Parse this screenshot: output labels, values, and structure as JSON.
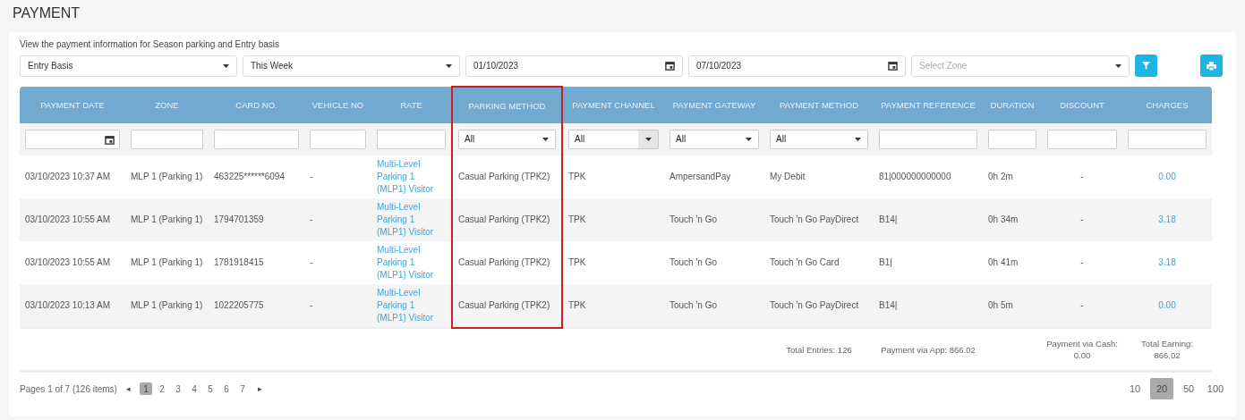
{
  "page_title": "PAYMENT",
  "description": "View the payment information for Season parking and Entry basis",
  "filters": [
    {
      "kind": "select",
      "value": "Entry Basis"
    },
    {
      "kind": "select",
      "value": "This Week"
    },
    {
      "kind": "date",
      "value": "01/10/2023"
    },
    {
      "kind": "date",
      "value": "07/10/2023"
    },
    {
      "kind": "select",
      "placeholder": "Select Zone"
    }
  ],
  "table": {
    "columns": [
      {
        "label": "PAYMENT DATE",
        "filter": {
          "kind": "date"
        },
        "highlighted": false
      },
      {
        "label": "ZONE",
        "filter": {
          "kind": "text"
        },
        "highlighted": false
      },
      {
        "label": "CARD NO.",
        "filter": {
          "kind": "text"
        },
        "highlighted": false
      },
      {
        "label": "VEHICLE NO",
        "filter": {
          "kind": "text"
        },
        "highlighted": false
      },
      {
        "label": "RATE",
        "filter": {
          "kind": "text"
        },
        "highlighted": false
      },
      {
        "label": "PARKING METHOD",
        "filter": {
          "kind": "select",
          "value": "All"
        },
        "highlighted": true
      },
      {
        "label": "PAYMENT CHANNEL",
        "filter": {
          "kind": "combo",
          "value": "All"
        },
        "highlighted": false
      },
      {
        "label": "PAYMENT GATEWAY",
        "filter": {
          "kind": "select",
          "value": "All"
        },
        "highlighted": false
      },
      {
        "label": "PAYMENT METHOD",
        "filter": {
          "kind": "select",
          "value": "All"
        },
        "highlighted": false
      },
      {
        "label": "PAYMENT REFERENCE",
        "filter": {
          "kind": "text"
        },
        "highlighted": false
      },
      {
        "label": "DURATION",
        "filter": {
          "kind": "text"
        },
        "highlighted": false
      },
      {
        "label": "DISCOUNT",
        "filter": {
          "kind": "text"
        },
        "highlighted": false
      },
      {
        "label": "CHARGES",
        "filter": {
          "kind": "text"
        },
        "highlighted": false
      }
    ],
    "rows": [
      [
        "03/10/2023 10:37 AM",
        "MLP 1 (Parking 1)",
        "463225******6094",
        "-",
        "Multi-Level Parking 1 (MLP1) Visitor",
        "Casual Parking (TPK2)",
        "TPK",
        "AmpersandPay",
        "My Debit",
        "81|000000000000",
        "0h 2m",
        "-",
        "0.00"
      ],
      [
        "03/10/2023 10:55 AM",
        "MLP 1 (Parking 1)",
        "1794701359",
        "-",
        "Multi-Level Parking 1 (MLP1) Visitor",
        "Casual Parking (TPK2)",
        "TPK",
        "Touch 'n Go",
        "Touch 'n Go PayDirect",
        "B14|",
        "0h 34m",
        "-",
        "3.18"
      ],
      [
        "03/10/2023 10:55 AM",
        "MLP 1 (Parking 1)",
        "1781918415",
        "-",
        "Multi-Level Parking 1 (MLP1) Visitor",
        "Casual Parking (TPK2)",
        "TPK",
        "Touch 'n Go",
        "Touch 'n Go Card",
        "B1|",
        "0h 41m",
        "-",
        "3.18"
      ],
      [
        "03/10/2023 10:13 AM",
        "MLP 1 (Parking 1)",
        "1022205775",
        "-",
        "Multi-Level Parking 1 (MLP1) Visitor",
        "Casual Parking (TPK2)",
        "TPK",
        "Touch 'n Go",
        "Touch 'n Go PayDirect",
        "B14|",
        "0h 5m",
        "-",
        "0.00"
      ]
    ],
    "totals": [
      {
        "lines": [
          "Total Entries: 126"
        ]
      },
      {
        "lines": [
          "Payment via App: 866.02"
        ]
      },
      {
        "lines": [
          "Payment via Cash:",
          "0.00"
        ]
      },
      {
        "lines": [
          "Total Earning:",
          "866.02"
        ]
      }
    ]
  },
  "pagination": {
    "summary": "Pages 1 of 7 (126 items)",
    "prev": "◂",
    "next": "▸",
    "pages": [
      {
        "label": "1",
        "selected": true
      },
      {
        "label": "2",
        "selected": false
      },
      {
        "label": "3",
        "selected": false
      },
      {
        "label": "4",
        "selected": false
      },
      {
        "label": "5",
        "selected": false
      },
      {
        "label": "6",
        "selected": false
      },
      {
        "label": "7",
        "selected": false
      }
    ],
    "page_sizes": [
      {
        "label": "10",
        "selected": false
      },
      {
        "label": "20",
        "selected": true
      },
      {
        "label": "50",
        "selected": false
      },
      {
        "label": "100",
        "selected": false
      }
    ]
  }
}
